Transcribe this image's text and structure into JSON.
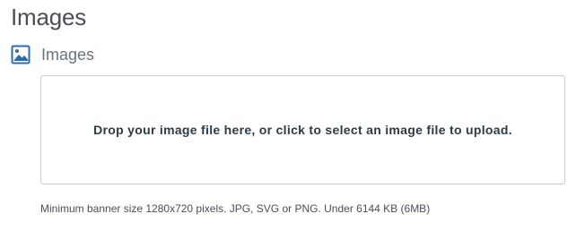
{
  "page": {
    "title": "Images"
  },
  "section": {
    "label": "Images",
    "icon": "image-icon",
    "icon_color": "#2b6cb0"
  },
  "dropzone": {
    "text": "Drop your image file here, or click to select an image file to upload."
  },
  "hint": {
    "text": "Minimum banner size 1280x720 pixels. JPG, SVG or PNG. Under 6144 KB (6MB)"
  }
}
